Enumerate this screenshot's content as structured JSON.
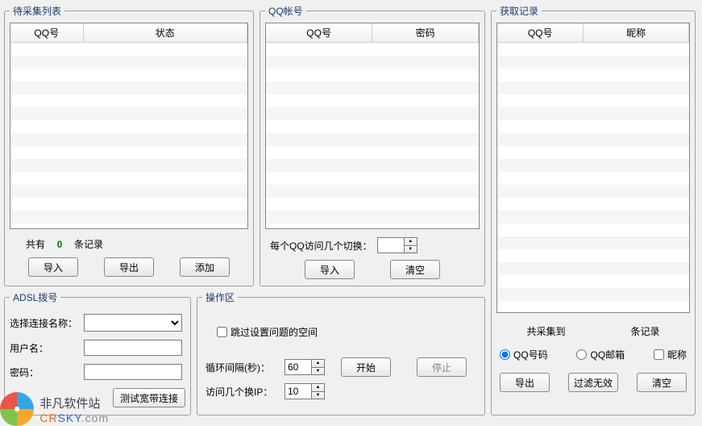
{
  "pending": {
    "legend": "待采集列表",
    "col_qq": "QQ号",
    "col_status": "状态",
    "total_prefix": "共有",
    "total_count": "0",
    "total_suffix": "条记录",
    "btn_import": "导入",
    "btn_export": "导出",
    "btn_add": "添加"
  },
  "accounts": {
    "legend": "QQ帐号",
    "col_qq": "QQ号",
    "col_pwd": "密码",
    "switch_label": "每个QQ访问几个切换：",
    "switch_value": "",
    "btn_import": "导入",
    "btn_clear": "清空"
  },
  "results": {
    "legend": "获取记录",
    "col_qq": "QQ号",
    "col_nick": "昵称",
    "summary_prefix": "共采集到",
    "summary_suffix": "条记录",
    "radio_qq": "QQ号码",
    "radio_mail": "QQ邮箱",
    "chk_nick": "昵称",
    "btn_export": "导出",
    "btn_filter": "过滤无效",
    "btn_clear": "清空"
  },
  "adsl": {
    "legend": "ADSL拨号",
    "label_conn": "选择连接名称：",
    "label_user": "用户名：",
    "label_pwd": "密码：",
    "btn_test": "测试宽带连接"
  },
  "ops": {
    "legend": "操作区",
    "chk_skip": "跳过设置问题的空间",
    "label_interval": "循环间隔(秒)：",
    "interval_value": "60",
    "label_ipswitch": "访问几个换IP：",
    "ipswitch_value": "10",
    "btn_start": "开始",
    "btn_stop": "停止"
  },
  "watermark": {
    "line1": "非凡软件站",
    "brand1": "CR",
    "brand2": "SKY",
    "brand3": ".com"
  }
}
